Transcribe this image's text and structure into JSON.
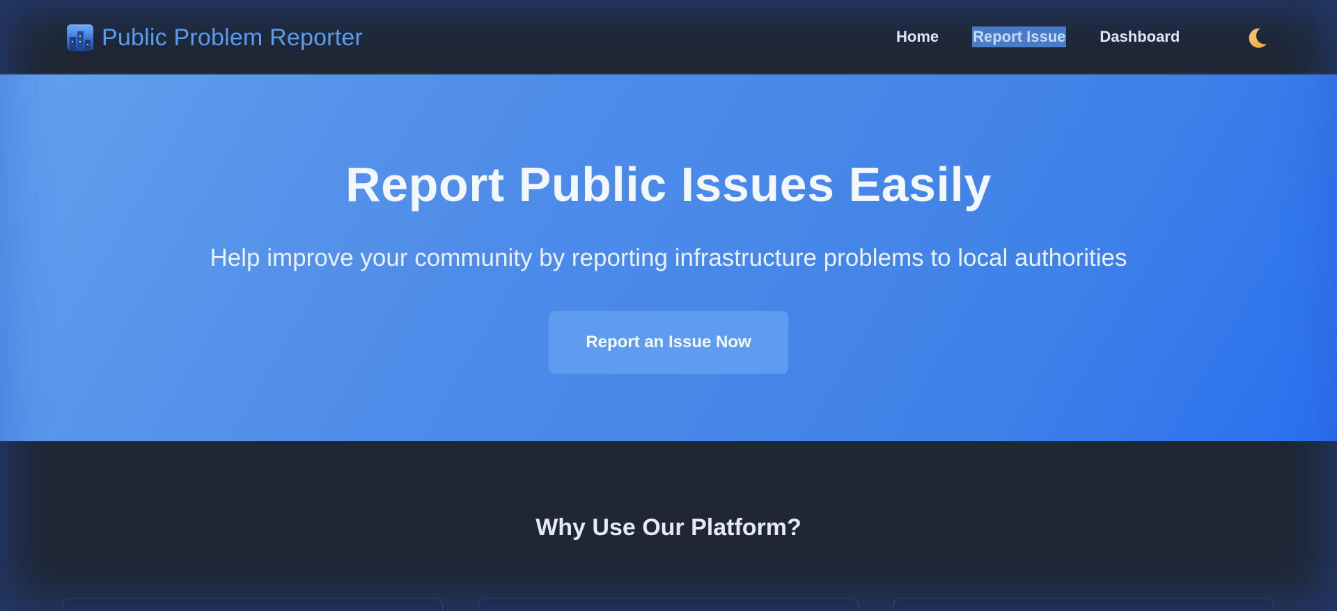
{
  "navbar": {
    "brand": "Public Problem Reporter",
    "brand_icon": "city-buildings-icon",
    "links": [
      {
        "label": "Home"
      },
      {
        "label": "Report Issue"
      },
      {
        "label": "Dashboard"
      }
    ],
    "theme_toggle_icon": "crescent-moon-icon"
  },
  "hero": {
    "title": "Report Public Issues Easily",
    "subtitle": "Help improve your community by reporting infrastructure problems to local authorities",
    "cta_label": "Report an Issue Now"
  },
  "features": {
    "title": "Why Use Our Platform?"
  },
  "colors": {
    "nav_background": "#1f2735",
    "brand_text": "#5aa0f2",
    "hero_gradient_start": "#62a0ee",
    "hero_gradient_end": "#2b6ff0",
    "cta_background": "#5f9cef",
    "selected_link_highlight": "#4a7ec9"
  }
}
